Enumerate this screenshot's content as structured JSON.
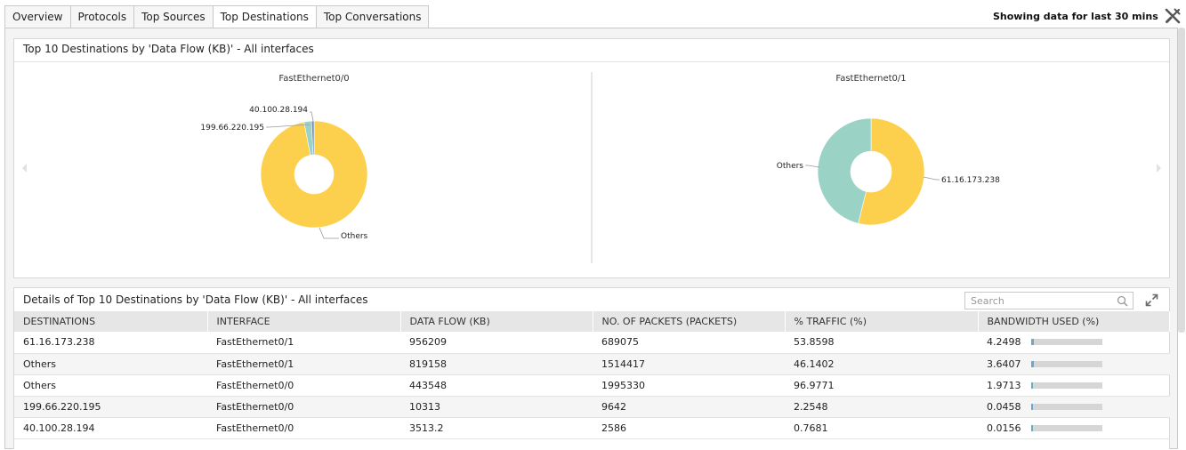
{
  "tabs": [
    {
      "label": "Overview",
      "active": false
    },
    {
      "label": "Protocols",
      "active": false
    },
    {
      "label": "Top Sources",
      "active": false
    },
    {
      "label": "Top Destinations",
      "active": true
    },
    {
      "label": "Top Conversations",
      "active": false
    }
  ],
  "header": {
    "showing_text": "Showing data for last 30 mins",
    "tools_icon": "tools-icon"
  },
  "chart_panel": {
    "title": "Top 10 Destinations by 'Data Flow (KB)' - All interfaces",
    "prev_icon": "chevron-left-icon",
    "next_icon": "chevron-right-icon"
  },
  "chart_data": [
    {
      "type": "pie",
      "title": "FastEthernet0/0",
      "slices": [
        {
          "label": "Others",
          "value": 443548,
          "color": "#fccf4d"
        },
        {
          "label": "199.66.220.195",
          "value": 10313,
          "color": "#9ad3c6"
        },
        {
          "label": "40.100.28.194",
          "value": 3513.2,
          "color": "#6b8fb8"
        }
      ]
    },
    {
      "type": "pie",
      "title": "FastEthernet0/1",
      "slices": [
        {
          "label": "61.16.173.238",
          "value": 956209,
          "color": "#fccf4d"
        },
        {
          "label": "Others",
          "value": 819158,
          "color": "#9ad3c6"
        }
      ]
    }
  ],
  "table_panel": {
    "title": "Details of Top 10 Destinations by 'Data Flow (KB)' - All interfaces",
    "search_placeholder": "Search",
    "search_value": "",
    "expand_icon": "expand-icon",
    "columns": [
      "DESTINATIONS",
      "INTERFACE",
      "DATA FLOW (KB)",
      "NO. OF PACKETS (PACKETS)",
      "% TRAFFIC (%)",
      "BANDWIDTH USED (%)"
    ],
    "bar_color": "#6aa9c9",
    "rows": [
      {
        "destination": "61.16.173.238",
        "interface": "FastEthernet0/1",
        "data_flow": "956209",
        "packets": "689075",
        "traffic": "53.8598",
        "bandwidth": "4.2498",
        "bandwidth_fraction": 0.042498
      },
      {
        "destination": "Others",
        "interface": "FastEthernet0/1",
        "data_flow": "819158",
        "packets": "1514417",
        "traffic": "46.1402",
        "bandwidth": "3.6407",
        "bandwidth_fraction": 0.036407
      },
      {
        "destination": "Others",
        "interface": "FastEthernet0/0",
        "data_flow": "443548",
        "packets": "1995330",
        "traffic": "96.9771",
        "bandwidth": "1.9713",
        "bandwidth_fraction": 0.019713
      },
      {
        "destination": "199.66.220.195",
        "interface": "FastEthernet0/0",
        "data_flow": "10313",
        "packets": "9642",
        "traffic": "2.2548",
        "bandwidth": "0.0458",
        "bandwidth_fraction": 0.000458
      },
      {
        "destination": "40.100.28.194",
        "interface": "FastEthernet0/0",
        "data_flow": "3513.2",
        "packets": "2586",
        "traffic": "0.7681",
        "bandwidth": "0.0156",
        "bandwidth_fraction": 0.000156
      }
    ]
  }
}
